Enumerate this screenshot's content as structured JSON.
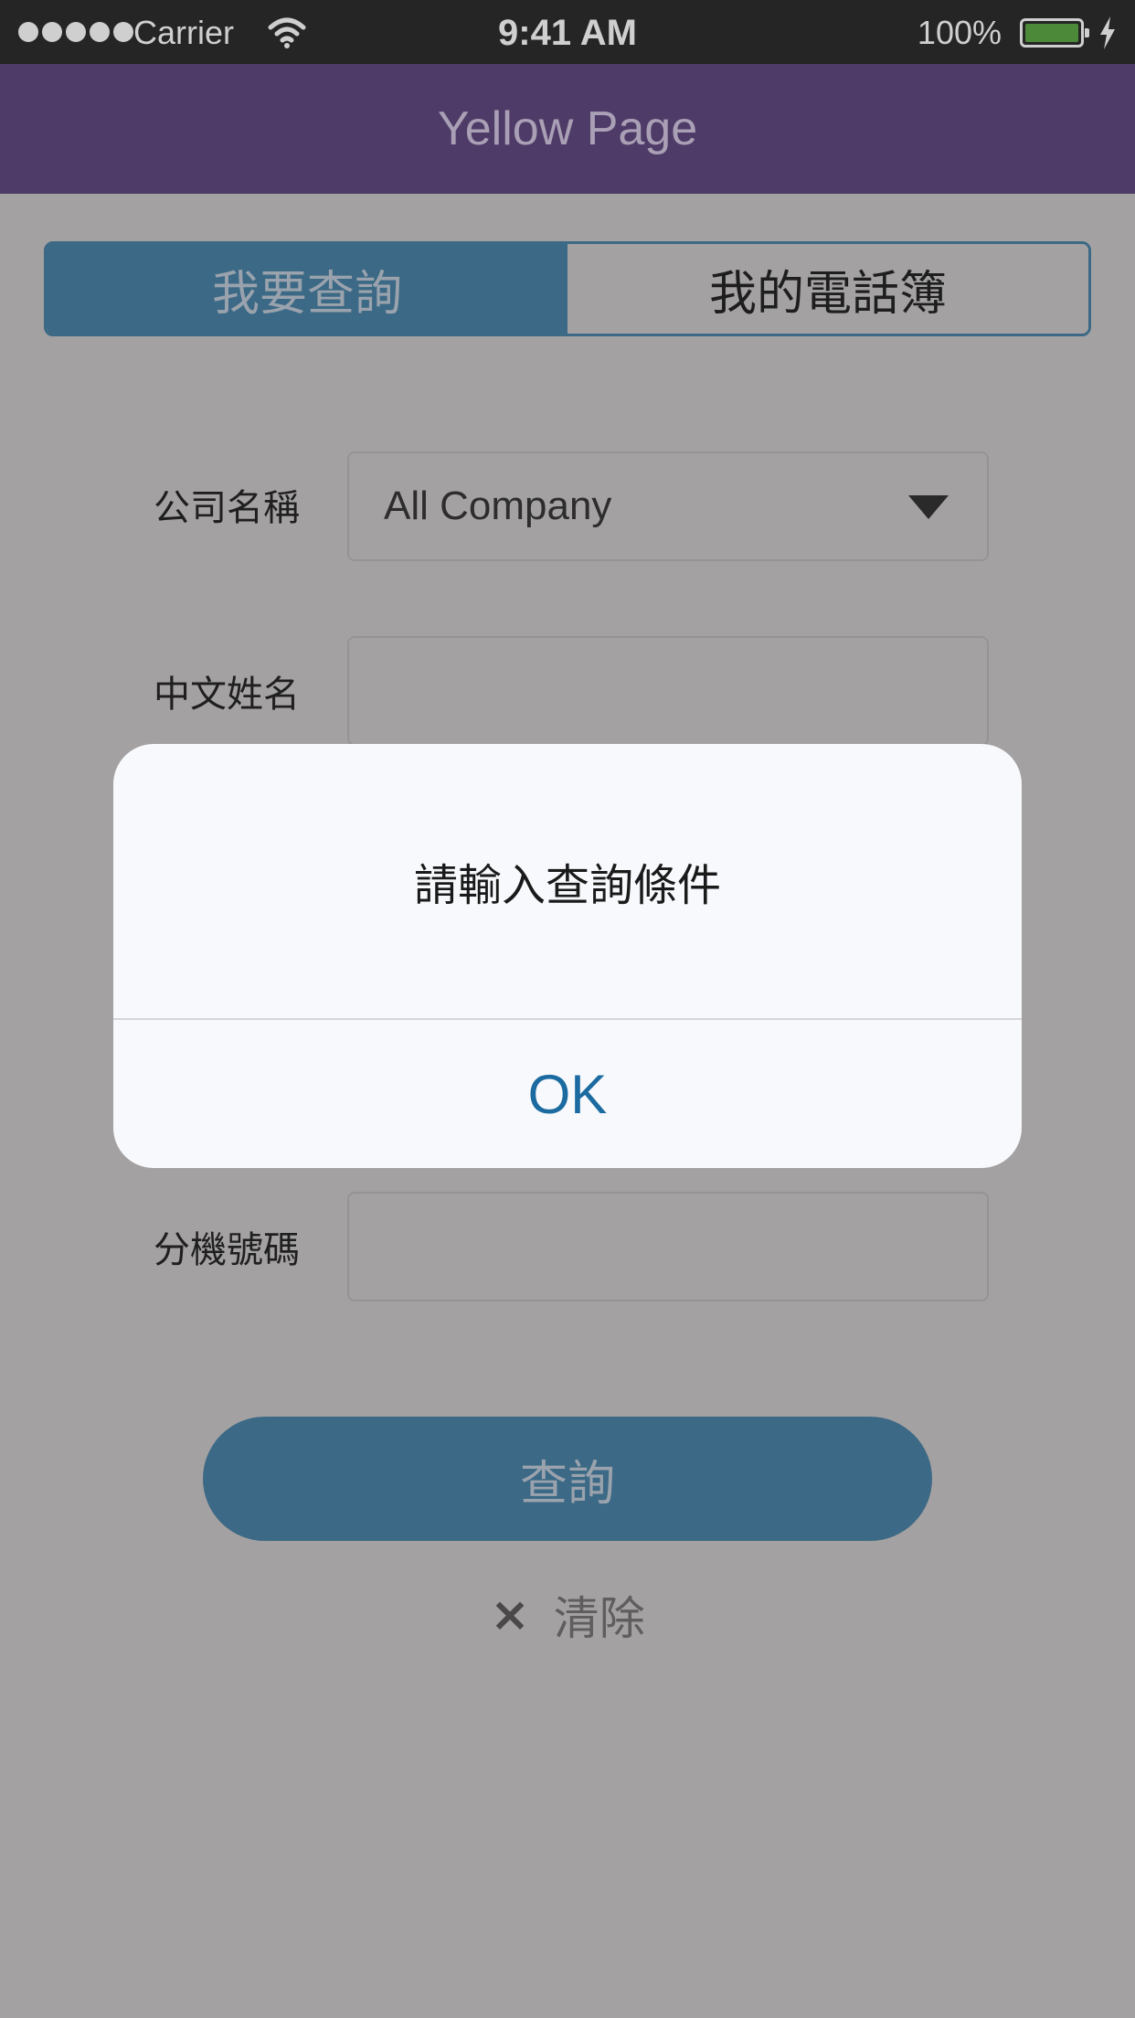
{
  "status_bar": {
    "carrier": "Carrier",
    "time": "9:41 AM",
    "battery": "100%",
    "icons": [
      "signal-dots-icon",
      "wifi-icon",
      "battery-icon",
      "charging-bolt-icon"
    ]
  },
  "nav": {
    "title": "Yellow Page"
  },
  "segments": {
    "search": "我要查詢",
    "phonebook": "我的電話簿"
  },
  "form": {
    "company_label": "公司名稱",
    "company_value": "All Company",
    "chinese_name_label": "中文姓名",
    "chinese_name_value": "",
    "extension_label": "分機號碼",
    "extension_value": ""
  },
  "actions": {
    "search": "查詢",
    "clear_icon": "×",
    "clear": "清除"
  },
  "alert": {
    "message": "請輸入查詢條件",
    "ok": "OK"
  },
  "colors": {
    "nav_background": "#4f3b67",
    "accent": "#3c6985",
    "ok_text": "#1b6aa0",
    "overlay": "#a4a1a2",
    "battery_fill": "#4c8a3a"
  }
}
